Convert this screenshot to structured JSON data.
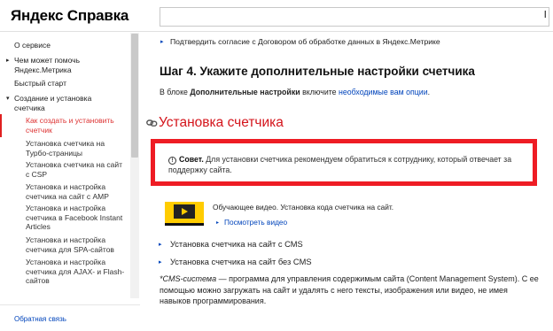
{
  "header": {
    "logo": "Яндекс Справка",
    "search_placeholder": "",
    "search_edge_char": "l"
  },
  "sidebar": {
    "items": [
      {
        "label": "О сервисе"
      },
      {
        "label": "Чем может помочь Яндекс.Метрика",
        "arrow": "▸"
      },
      {
        "label": "Быстрый старт"
      },
      {
        "label": "Создание и установка счетчика",
        "arrow": "▾"
      }
    ],
    "subitems": [
      {
        "label": "Как создать и установить счетчик",
        "active": true
      },
      {
        "label": "Установка счетчика на Турбо-страницы"
      },
      {
        "label": "Установка счетчика на сайт с CSP"
      },
      {
        "label": "Установка и настройка счетчика на сайт с AMP"
      },
      {
        "label": "Установка и настройка счетчика в Facebook Instant Articles"
      },
      {
        "label": "Установка и настройка счетчика для SPA-сайтов"
      },
      {
        "label": "Установка и настройка счетчика для AJAX- и Flash-сайтов"
      }
    ],
    "feedback": "Обратная связь"
  },
  "main": {
    "top_link": "Подтвердить согласие с Договором об обработке данных в Яндекс.Метрике",
    "step_heading": "Шаг 4. Укажите дополнительные настройки счетчика",
    "step_text_prefix": "В блоке ",
    "step_text_bold": "Дополнительные настройки",
    "step_text_mid": " включите ",
    "step_text_link": "необходимые вам опции",
    "step_text_suffix": ".",
    "section_title": "Установка счетчика",
    "tip_label": "Совет.",
    "tip_text": " Для установки счетчика рекомендуем обратиться к сотруднику, который отвечает за поддержку сайта.",
    "video_desc": "Обучающее видео. Установка кода счетчика на сайт.",
    "video_link": "Посмотреть видео",
    "link_cms": "Установка счетчика на сайт с CMS",
    "link_no_cms": "Установка счетчика на сайт без CMS",
    "def_term": "*CMS-система",
    "def_text": " — программа для управления содержимым сайта (Content Management System). С ее помощью можно загружать на сайт и удалять с него тексты, изображения или видео, не имея навыков программирования."
  },
  "colors": {
    "accent_red": "#ee1c24",
    "link_blue": "#0044bb",
    "video_yellow": "#ffcc00"
  }
}
